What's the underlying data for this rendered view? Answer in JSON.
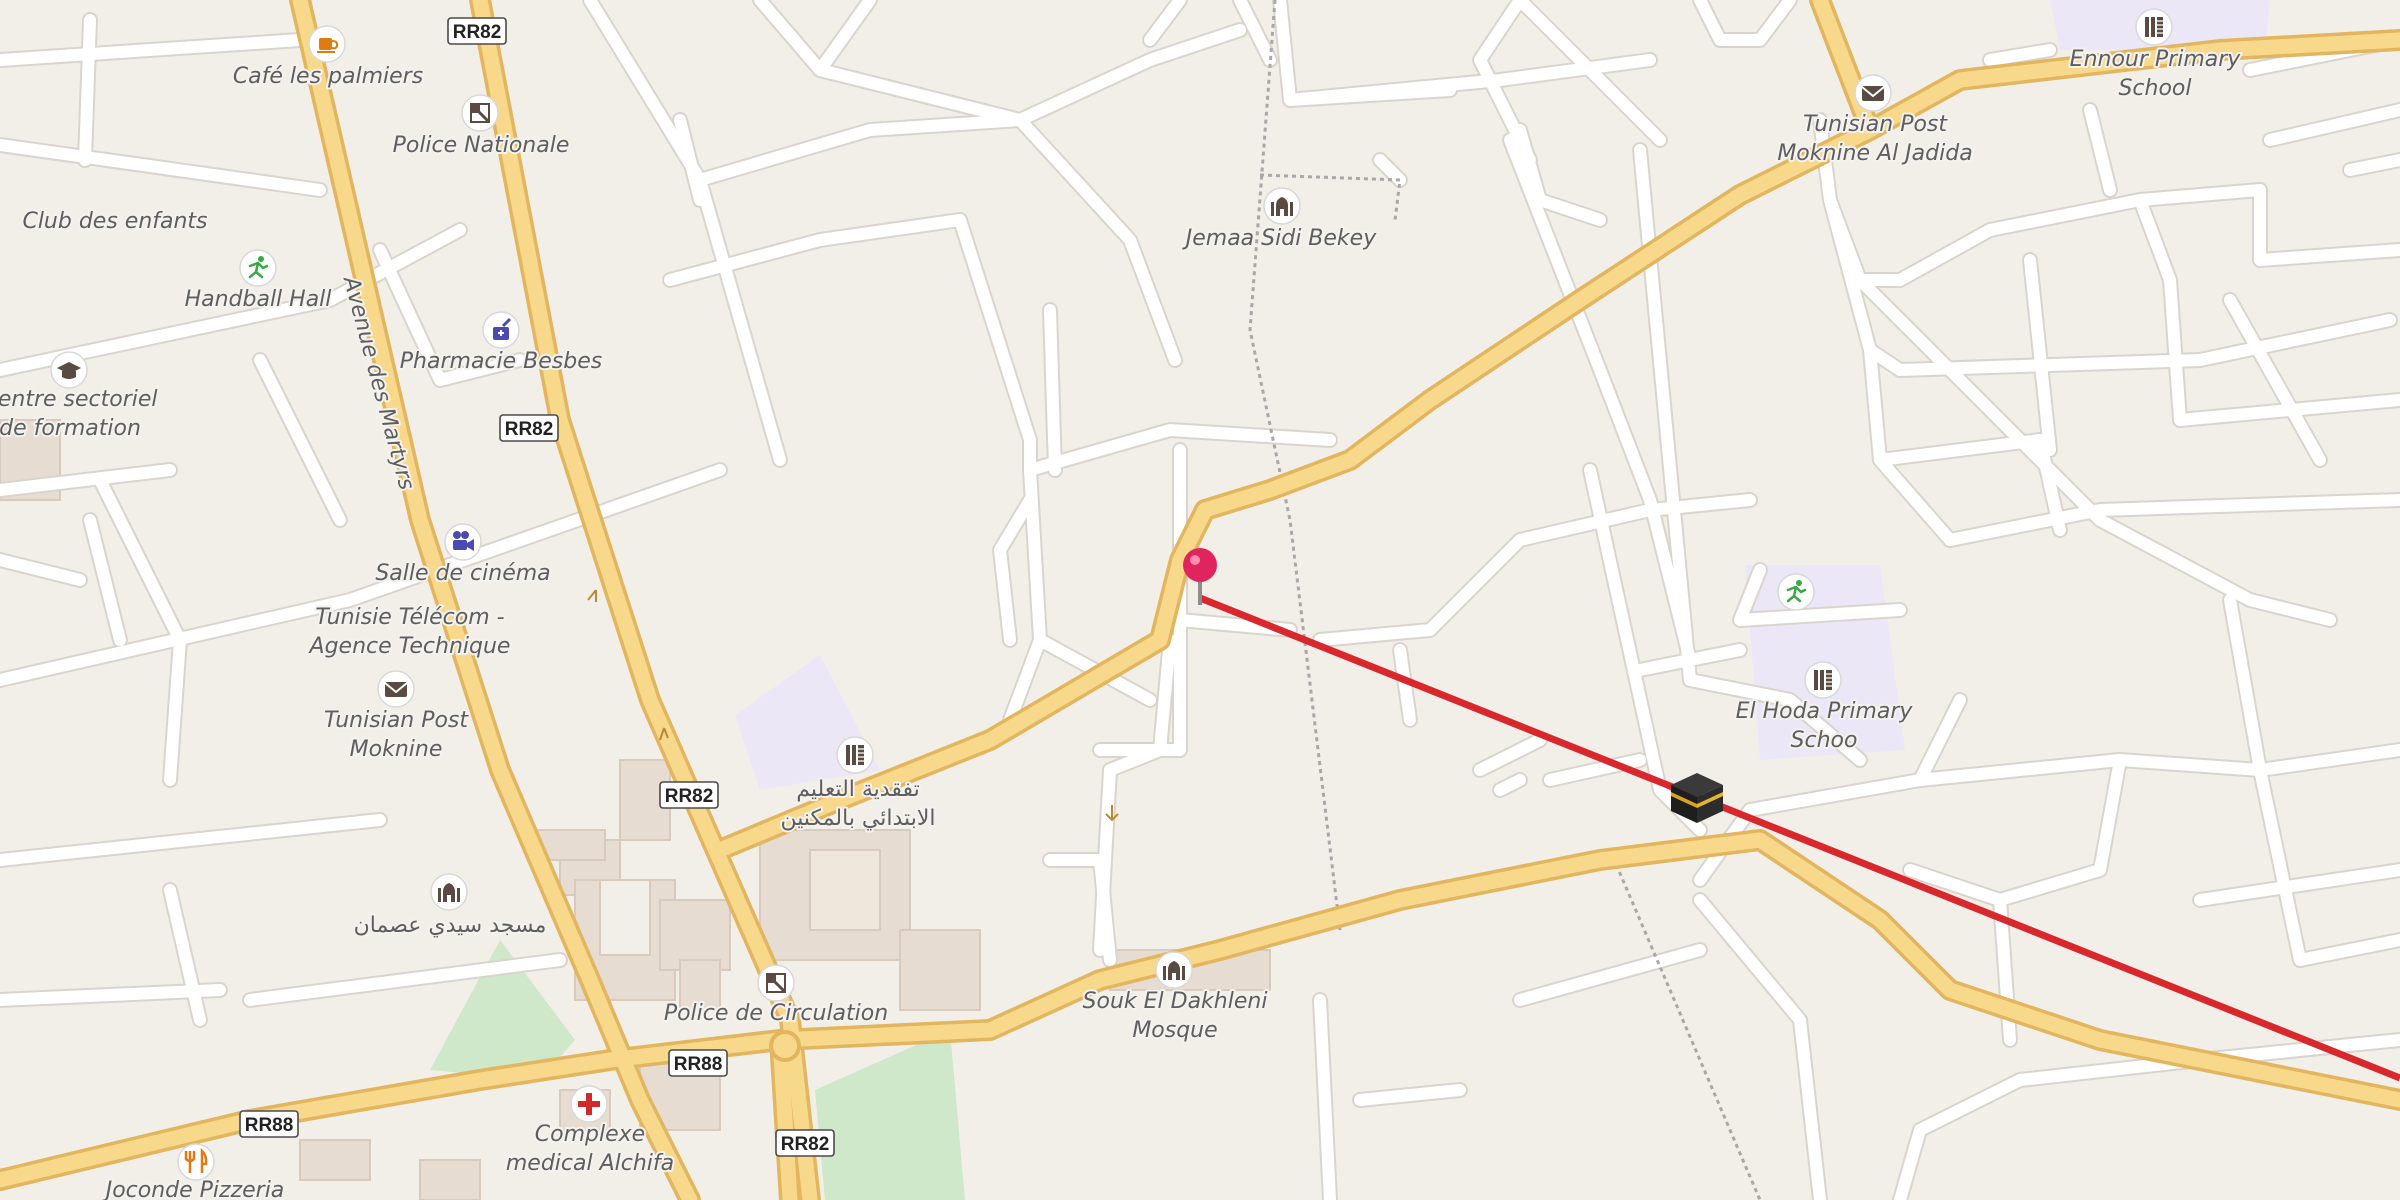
{
  "map": {
    "colors": {
      "background": "#f2efe9",
      "minor_road": "#ffffff",
      "major_road_fill": "#f8d88b",
      "major_road_casing": "#e5b963",
      "route_line": "#d9272e",
      "pin": "#e0245e",
      "school_area": "#ebe7f7",
      "park": "#cfe8c9",
      "building": "#e4d9cf"
    },
    "route_shields": [
      {
        "id": "rr82_top",
        "label": "RR82"
      },
      {
        "id": "rr82_mid",
        "label": "RR82"
      },
      {
        "id": "rr82_low",
        "label": "RR82"
      },
      {
        "id": "rr82_bottom",
        "label": "RR82"
      },
      {
        "id": "rr88_left",
        "label": "RR88"
      },
      {
        "id": "rr88_center",
        "label": "RR88"
      }
    ],
    "street_labels": {
      "avenue_des_martyrs": "Avenue des Martyrs"
    },
    "places": [
      {
        "id": "cafe",
        "lines": [
          "Café les palmiers"
        ],
        "icon": "coffee-icon"
      },
      {
        "id": "police_nat",
        "lines": [
          "Police Nationale"
        ],
        "icon": "police-icon"
      },
      {
        "id": "club",
        "lines": [
          "Club des enfants"
        ],
        "icon": ""
      },
      {
        "id": "handball",
        "lines": [
          "Handball Hall"
        ],
        "icon": "sport-icon"
      },
      {
        "id": "pharmacie",
        "lines": [
          "Pharmacie Besbes"
        ],
        "icon": "pharmacy-icon"
      },
      {
        "id": "centre",
        "lines": [
          "Centre sectoriel",
          "de formation"
        ],
        "icon": "graduation-cap-icon"
      },
      {
        "id": "cinema",
        "lines": [
          "Salle de cinéma"
        ],
        "icon": "cinema-icon"
      },
      {
        "id": "telecom",
        "lines": [
          "Tunisie Télécom -",
          "Agence Technique"
        ],
        "icon": ""
      },
      {
        "id": "post_moknine",
        "lines": [
          "Tunisian Post",
          "Moknine"
        ],
        "icon": "mail-icon"
      },
      {
        "id": "school_ar",
        "lines": [
          "تفقدية التعليم",
          "الابتدائي بالمكنين"
        ],
        "icon": "school-icon"
      },
      {
        "id": "mosque_ar",
        "lines": [
          "مسجد سيدي عصمان"
        ],
        "icon": "mosque-icon"
      },
      {
        "id": "police_circ",
        "lines": [
          "Police de Circulation"
        ],
        "icon": "police-icon"
      },
      {
        "id": "souk",
        "lines": [
          "Souk El Dakhleni",
          "Mosque"
        ],
        "icon": "mosque-icon"
      },
      {
        "id": "complexe",
        "lines": [
          "Complexe",
          "medical Alchifa"
        ],
        "icon": "medical-cross-icon"
      },
      {
        "id": "pizzeria",
        "lines": [
          "Joconde Pizzeria"
        ],
        "icon": "restaurant-icon"
      },
      {
        "id": "jemaa",
        "lines": [
          "Jemaa Sidi Bekey"
        ],
        "icon": "mosque-icon"
      },
      {
        "id": "post_jadida",
        "lines": [
          "Tunisian Post",
          "Moknine Al Jadida"
        ],
        "icon": "mail-icon"
      },
      {
        "id": "ennour",
        "lines": [
          "Ennour Primary",
          "School"
        ],
        "icon": "school-icon"
      },
      {
        "id": "elhoda",
        "lines": [
          "El Hoda Primary",
          "Schoo"
        ],
        "icon": "school-icon"
      },
      {
        "id": "elhoda_sport",
        "lines": [],
        "icon": "sport-icon"
      }
    ],
    "markers": {
      "location_pin": "map-pin-icon",
      "qibla_marker": "kaaba-icon",
      "route": "qibla-direction-line"
    }
  }
}
